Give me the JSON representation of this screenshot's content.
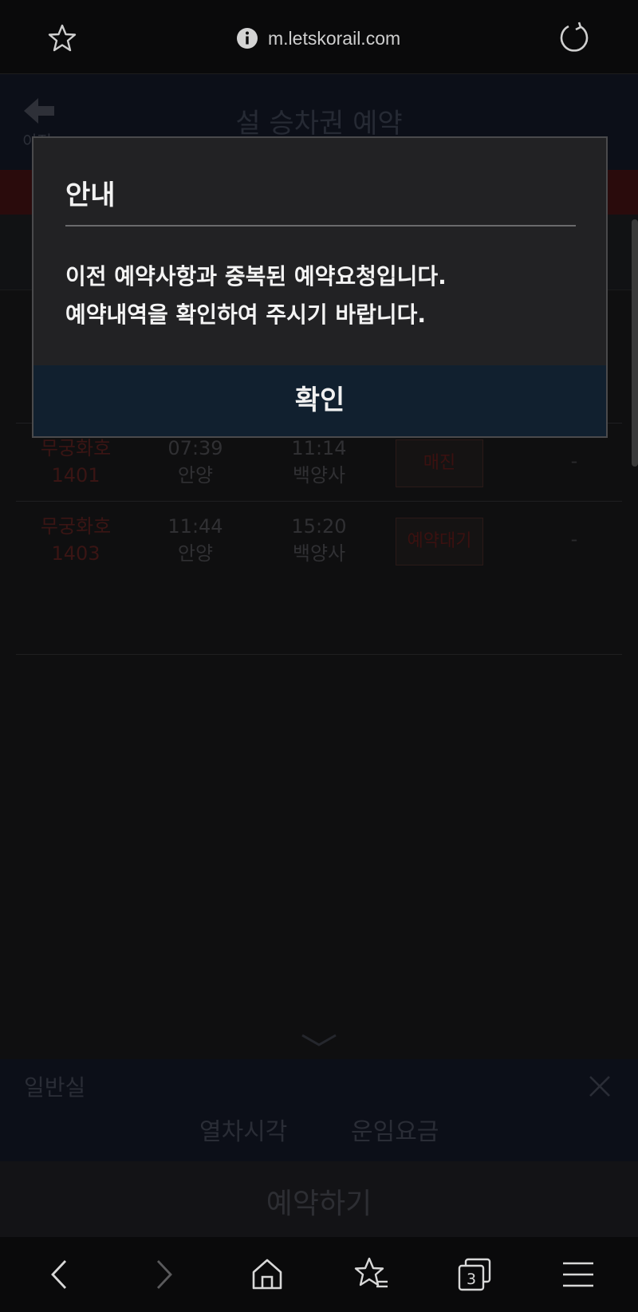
{
  "browser": {
    "url": "m.letskorail.com",
    "tab_count": "3"
  },
  "page": {
    "back_label": "이전",
    "title": "설 승차권 예약",
    "trains": [
      {
        "name": "무궁화호",
        "number": "1401",
        "dep_time": "07:39",
        "dep_station": "안양",
        "arr_time": "11:14",
        "arr_station": "백양사",
        "status": "매진",
        "extra": "-"
      },
      {
        "name": "무궁화호",
        "number": "1403",
        "dep_time": "11:44",
        "dep_station": "안양",
        "arr_time": "15:20",
        "arr_station": "백양사",
        "status": "예약대기",
        "extra": "-"
      }
    ],
    "class_panel": {
      "title": "일반실",
      "tab_time": "열차시각",
      "tab_fare": "운임요금"
    },
    "reserve_button": "예약하기"
  },
  "dialog": {
    "title": "안내",
    "message_line1": "이전 예약사항과 중복된 예약요청입니다.",
    "message_line2": "예약내역을 확인하여 주시기 바랍니다.",
    "ok_button": "확인"
  },
  "icons": {
    "bookmark": "star-icon",
    "info": "info-icon",
    "reload": "reload-icon",
    "back": "arrow-left-icon",
    "close": "close-icon",
    "nav_back": "chevron-left-icon",
    "nav_forward": "chevron-right-icon",
    "home": "home-icon",
    "bookmarks": "bookmark-list-icon",
    "tabs": "tabs-icon",
    "menu": "hamburger-menu-icon"
  },
  "colors": {
    "dialog_bg": "#222224",
    "dialog_button_bg": "#11202f",
    "accent_red": "#b0231f"
  }
}
